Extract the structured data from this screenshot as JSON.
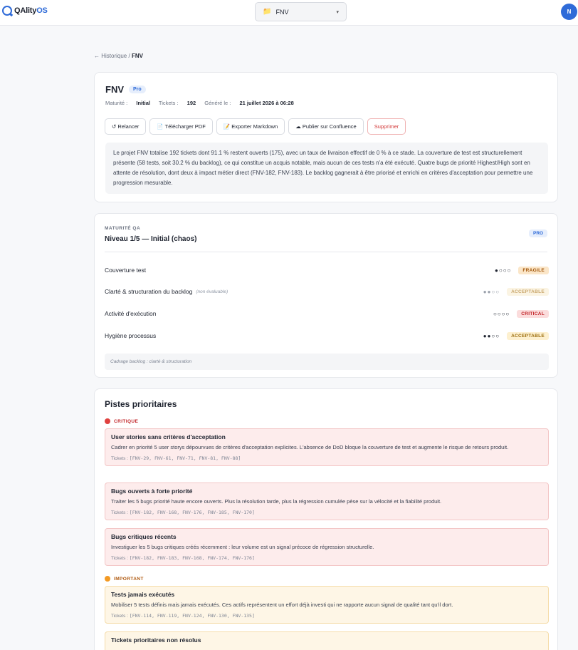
{
  "topbar": {
    "logo_q": "Q",
    "logo_name": "QAlity",
    "logo_os": "OS",
    "project_folder_icon": "📁",
    "project_name": "FNV",
    "project_caret": "▾",
    "avatar_initial": "N"
  },
  "breadcrumb": {
    "back": "← Historique",
    "sep": "/",
    "current": "FNV"
  },
  "report": {
    "title": "FNV",
    "plan": "Pro",
    "maturity_label": "Maturité :",
    "maturity_value": "Initial",
    "tickets_label": "Tickets :",
    "tickets_value": "192",
    "generated_label": "Généré le :",
    "generated_value": "21 juillet 2026 à 06:28",
    "actions": {
      "rerun": "↺ Relancer",
      "pdf": "📄 Télécharger PDF",
      "markdown": "📝 Exporter Markdown",
      "confluence": "☁ Publier sur Confluence",
      "delete": "Supprimer"
    },
    "summary": "Le projet FNV totalise 192 tickets dont 91.1 % restent ouverts (175), avec un taux de livraison effectif de 0 % à ce stade. La couverture de test est structurellement présente (58 tests, soit 30.2 % du backlog), ce qui constitue un acquis notable, mais aucun de ces tests n'a été exécuté. Quatre bugs de priorité Highest/High sont en attente de résolution, dont deux à impact métier direct (FNV-182, FNV-183). Le backlog gagnerait à être priorisé et enrichi en critères d'acceptation pour permettre une progression mesurable."
  },
  "maturity": {
    "kicker": "MATURITÉ QA",
    "level": "Niveau 1/5 — Initial (chaos)",
    "plan": "PRO",
    "rows": [
      {
        "label": "Couverture test",
        "note": "",
        "dots": "●○○○",
        "badge": "FRAGILE"
      },
      {
        "label": "Clarté & structuration du backlog",
        "note": "(non évaluable)",
        "dots": "●●○○",
        "badge": "ACCEPTABLE"
      },
      {
        "label": "Activité d'exécution",
        "note": "",
        "dots": "○○○○",
        "badge": "CRITICAL"
      },
      {
        "label": "Hygiène processus",
        "note": "",
        "dots": "●●○○",
        "badge": "ACCEPTABLE"
      }
    ],
    "footnote": "Cadrage backlog : clarté & structuration"
  },
  "priorities": {
    "title": "Pistes prioritaires",
    "critique_label": "CRITIQUE",
    "important_label": "IMPORTANT",
    "tickets_label": "Tickets :",
    "items": [
      {
        "title": "User stories sans critères d'acceptation",
        "desc": "Cadrer en priorité 5 user storys dépourvues de critères d'acceptation explicites. L'absence de DoD bloque la couverture de test et augmente le risque de retours produit.",
        "tickets": "[FNV-29, FNV-61, FNV-71, FNV-81, FNV-88]"
      },
      {
        "title": "Bugs ouverts à forte priorité",
        "desc": "Traiter les 5 bugs priorité haute encore ouverts. Plus la résolution tarde, plus la régression cumulée pèse sur la vélocité et la fiabilité produit.",
        "tickets": "[FNV-182, FNV-168, FNV-176, FNV-185, FNV-170]"
      },
      {
        "title": "Bugs critiques récents",
        "desc": "Investiguer les 5 bugs critiques créés récemment : leur volume est un signal précoce de régression structurelle.",
        "tickets": "[FNV-182, FNV-183, FNV-168, FNV-174, FNV-176]"
      },
      {
        "title": "Tests jamais exécutés",
        "desc": "Mobiliser 5 tests définis mais jamais exécutés. Ces actifs représentent un effort déjà investi qui ne rapporte aucun signal de qualité tant qu'il dort.",
        "tickets": "[FNV-114, FNV-119, FNV-124, FNV-130, FNV-135]"
      },
      {
        "title": "Tickets prioritaires non résolus",
        "desc": "",
        "tickets": ""
      }
    ]
  }
}
